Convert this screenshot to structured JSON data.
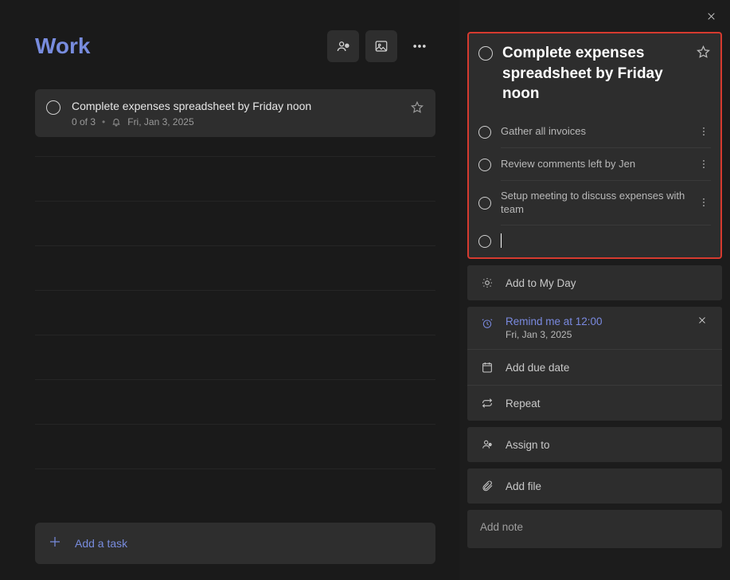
{
  "list": {
    "title": "Work",
    "add_task_placeholder": "Add a task"
  },
  "task": {
    "title": "Complete expenses spreadsheet by Friday noon",
    "progress": "0 of 3",
    "reminder_date": "Fri, Jan 3, 2025"
  },
  "detail": {
    "title": "Complete expenses spreadsheet by Friday noon",
    "steps": [
      {
        "text": "Gather all invoices"
      },
      {
        "text": "Review comments left by Jen"
      },
      {
        "text": "Setup meeting to discuss expenses with team"
      }
    ],
    "new_step_value": "",
    "add_to_my_day": "Add to My Day",
    "reminder": {
      "label": "Remind me at 12:00",
      "date": "Fri, Jan 3, 2025"
    },
    "add_due_date": "Add due date",
    "repeat": "Repeat",
    "assign_to": "Assign to",
    "add_file": "Add file",
    "add_note": "Add note"
  }
}
